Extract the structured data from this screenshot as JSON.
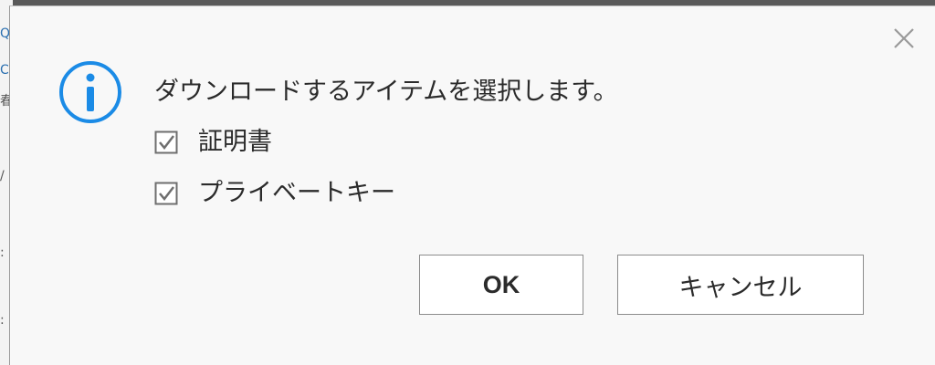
{
  "background": {
    "glyphs": [
      "Q",
      "C",
      "春",
      "/",
      ":",
      ":"
    ]
  },
  "dialog": {
    "icon": "info-icon",
    "close_icon": "close-icon",
    "message": "ダウンロードするアイテムを選択します。",
    "options": [
      {
        "label": "証明書",
        "checked": true
      },
      {
        "label": "プライベートキー",
        "checked": true
      }
    ],
    "buttons": {
      "ok": "OK",
      "cancel": "キャンセル"
    }
  },
  "colors": {
    "icon_blue": "#1b8be6",
    "dialog_bg": "#f8f8f8",
    "button_border": "#8c8c8c",
    "text": "#2b2b2b"
  }
}
